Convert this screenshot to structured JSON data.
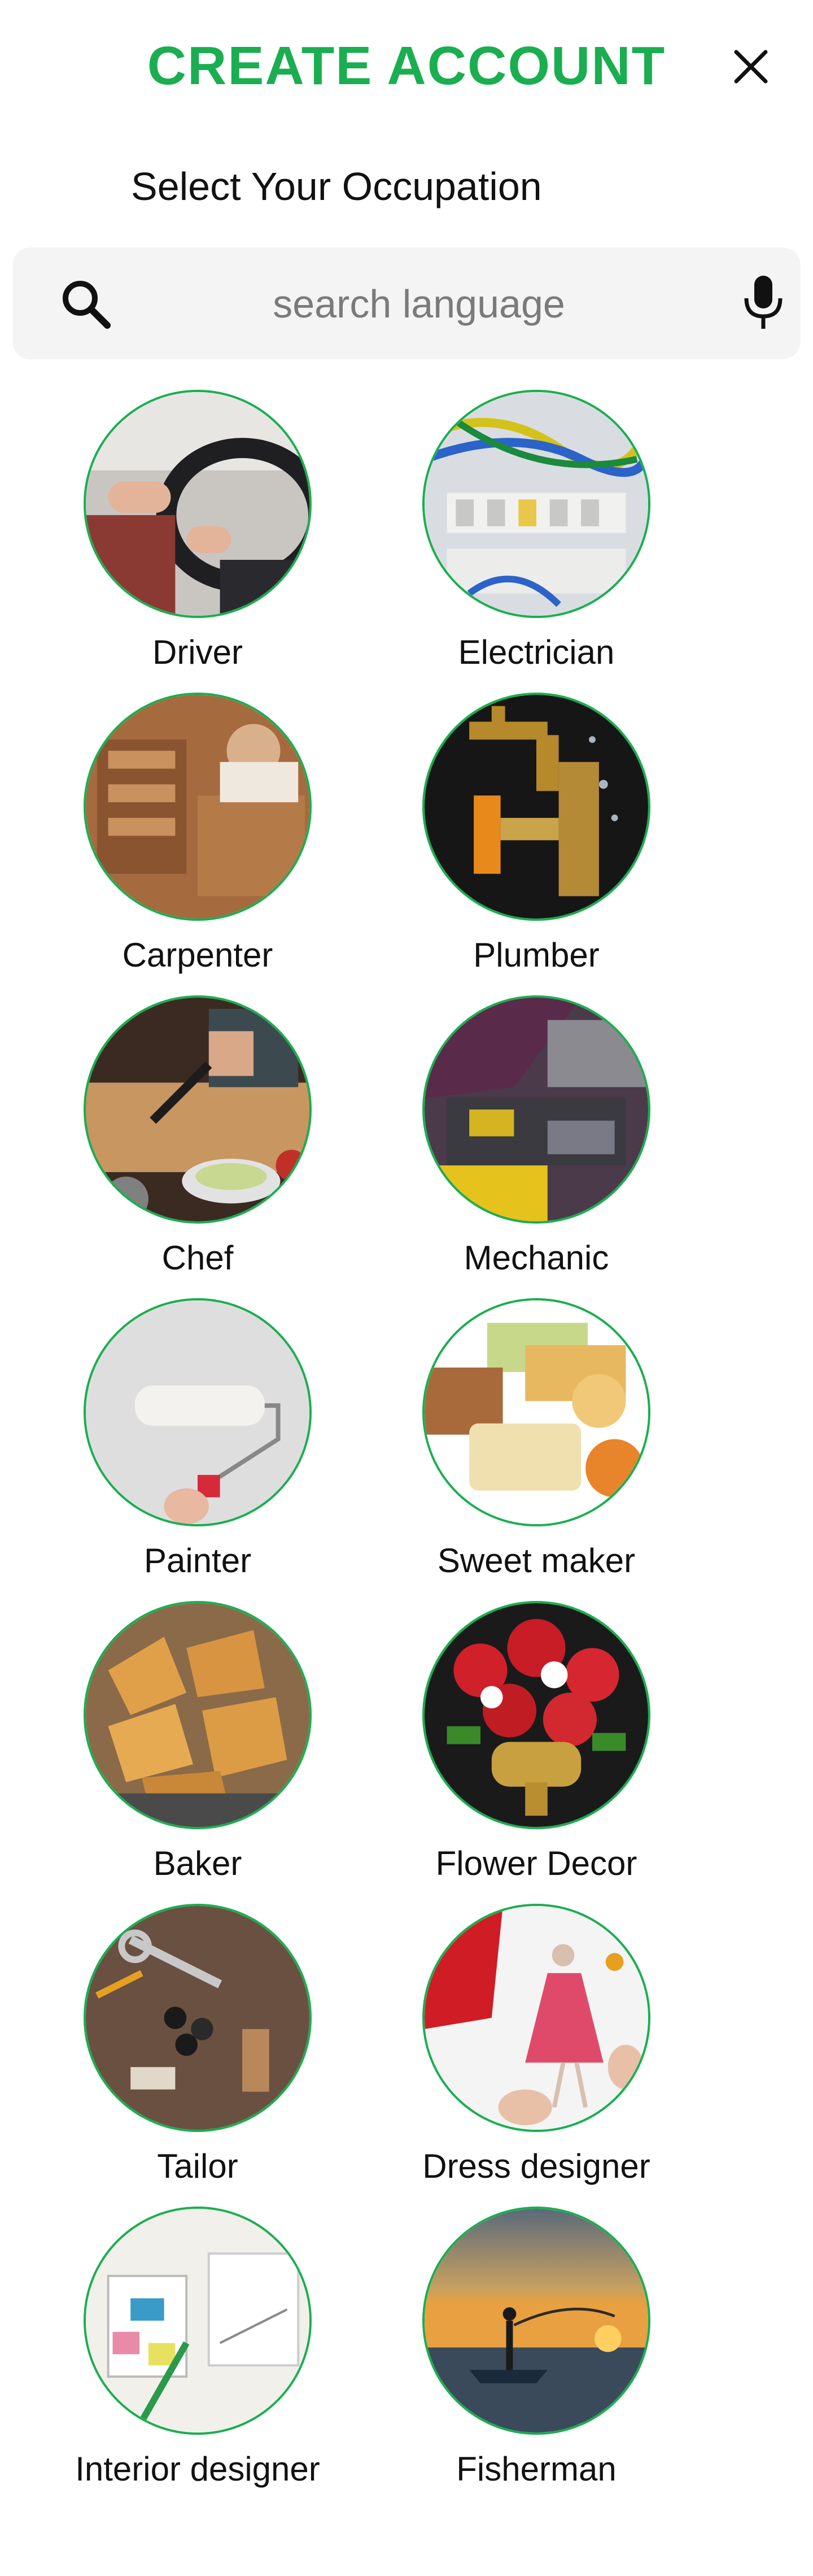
{
  "header": {
    "title": "CREATE ACCOUNT",
    "close_label": "close"
  },
  "subtitle": "Select Your Occupation",
  "search": {
    "placeholder": "search language",
    "value": ""
  },
  "occupations": [
    {
      "label": "Driver"
    },
    {
      "label": "Electrician"
    },
    {
      "label": "Carpenter"
    },
    {
      "label": "Plumber"
    },
    {
      "label": "Chef"
    },
    {
      "label": "Mechanic"
    },
    {
      "label": "Painter"
    },
    {
      "label": "Sweet maker"
    },
    {
      "label": "Baker"
    },
    {
      "label": "Flower Decor"
    },
    {
      "label": "Tailor"
    },
    {
      "label": "Dress designer"
    },
    {
      "label": "Interior designer"
    },
    {
      "label": "Fisherman"
    }
  ],
  "colors": {
    "accent": "#1aae50",
    "search_bg": "#f4f4f4",
    "placeholder": "#7a7a7a"
  },
  "icons": {
    "search": "search-icon",
    "mic": "mic-icon",
    "close": "close-icon"
  }
}
